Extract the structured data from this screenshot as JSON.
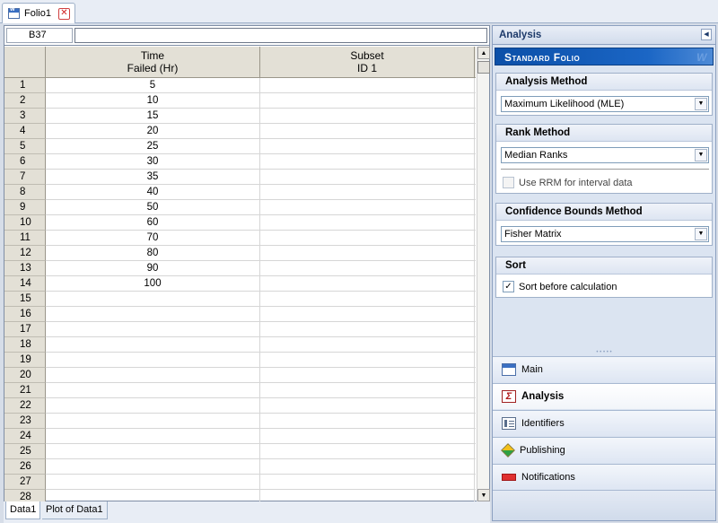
{
  "doc_tab": {
    "label": "Folio1",
    "icon": "folio-icon",
    "close_icon": "close-icon"
  },
  "formula_bar": {
    "cell_ref": "B37",
    "formula": ""
  },
  "grid": {
    "columns": [
      {
        "line1": "Time",
        "line2": "Failed (Hr)"
      },
      {
        "line1": "Subset",
        "line2": "ID 1"
      }
    ],
    "rows": [
      {
        "n": "1",
        "c1": "5",
        "c2": ""
      },
      {
        "n": "2",
        "c1": "10",
        "c2": ""
      },
      {
        "n": "3",
        "c1": "15",
        "c2": ""
      },
      {
        "n": "4",
        "c1": "20",
        "c2": ""
      },
      {
        "n": "5",
        "c1": "25",
        "c2": ""
      },
      {
        "n": "6",
        "c1": "30",
        "c2": ""
      },
      {
        "n": "7",
        "c1": "35",
        "c2": ""
      },
      {
        "n": "8",
        "c1": "40",
        "c2": ""
      },
      {
        "n": "9",
        "c1": "50",
        "c2": ""
      },
      {
        "n": "10",
        "c1": "60",
        "c2": ""
      },
      {
        "n": "11",
        "c1": "70",
        "c2": ""
      },
      {
        "n": "12",
        "c1": "80",
        "c2": ""
      },
      {
        "n": "13",
        "c1": "90",
        "c2": ""
      },
      {
        "n": "14",
        "c1": "100",
        "c2": ""
      },
      {
        "n": "15",
        "c1": "",
        "c2": ""
      },
      {
        "n": "16",
        "c1": "",
        "c2": ""
      },
      {
        "n": "17",
        "c1": "",
        "c2": ""
      },
      {
        "n": "18",
        "c1": "",
        "c2": ""
      },
      {
        "n": "19",
        "c1": "",
        "c2": ""
      },
      {
        "n": "20",
        "c1": "",
        "c2": ""
      },
      {
        "n": "21",
        "c1": "",
        "c2": ""
      },
      {
        "n": "22",
        "c1": "",
        "c2": ""
      },
      {
        "n": "23",
        "c1": "",
        "c2": ""
      },
      {
        "n": "24",
        "c1": "",
        "c2": ""
      },
      {
        "n": "25",
        "c1": "",
        "c2": ""
      },
      {
        "n": "26",
        "c1": "",
        "c2": ""
      },
      {
        "n": "27",
        "c1": "",
        "c2": ""
      },
      {
        "n": "28",
        "c1": "",
        "c2": ""
      }
    ]
  },
  "sheet_tabs": [
    "Data1",
    "Plot of Data1"
  ],
  "panel": {
    "title": "Analysis",
    "banner": "Standard Folio",
    "banner_mark": "W",
    "analysis_method": {
      "title": "Analysis Method",
      "value": "Maximum Likelihood (MLE)"
    },
    "rank_method": {
      "title": "Rank Method",
      "value": "Median Ranks",
      "rrm_label": "Use RRM for interval data",
      "rrm_checked": false
    },
    "confidence_bounds": {
      "title": "Confidence Bounds Method",
      "value": "Fisher Matrix"
    },
    "sort": {
      "title": "Sort",
      "label": "Sort before calculation",
      "checked": true,
      "check_glyph": "✓"
    },
    "nav": [
      {
        "label": "Main",
        "icon": "main-icon"
      },
      {
        "label": "Analysis",
        "icon": "analysis-icon",
        "active": true
      },
      {
        "label": "Identifiers",
        "icon": "identifiers-icon"
      },
      {
        "label": "Publishing",
        "icon": "publishing-icon"
      },
      {
        "label": "Notifications",
        "icon": "notifications-icon"
      }
    ]
  }
}
